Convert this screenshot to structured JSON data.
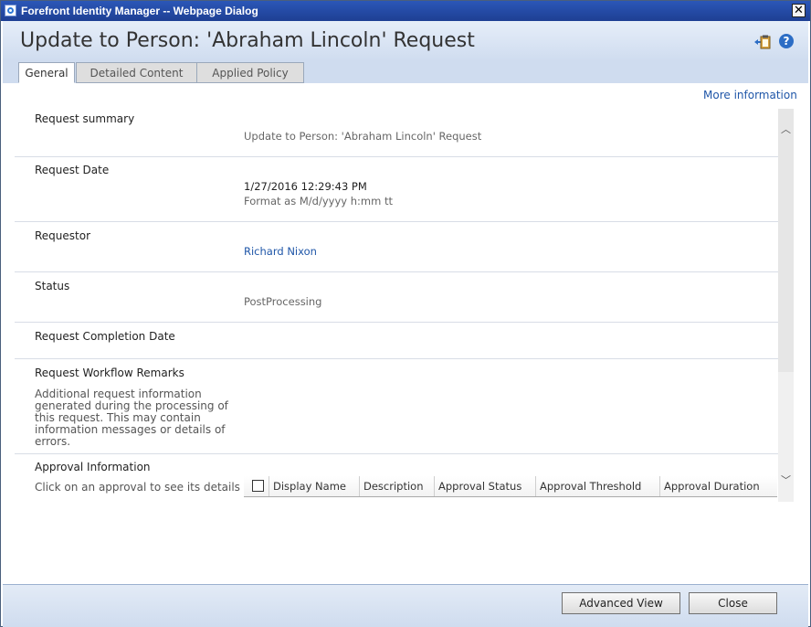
{
  "window": {
    "title": "Forefront Identity Manager -- Webpage Dialog",
    "close_glyph": "✕"
  },
  "header": {
    "title": "Update to Person: 'Abraham Lincoln' Request"
  },
  "tabs": [
    {
      "label": "General"
    },
    {
      "label": "Detailed Content"
    },
    {
      "label": "Applied Policy"
    }
  ],
  "more_info": "More information",
  "fields": {
    "summary": {
      "label": "Request summary",
      "value": "Update to Person: 'Abraham Lincoln' Request"
    },
    "date": {
      "label": "Request Date",
      "value": "1/27/2016 12:29:43 PM",
      "hint": "Format as M/d/yyyy h:mm tt"
    },
    "requestor": {
      "label": "Requestor",
      "value": "Richard Nixon"
    },
    "status": {
      "label": "Status",
      "value": "PostProcessing"
    },
    "completion": {
      "label": "Request Completion Date"
    },
    "remarks": {
      "label": "Request Workflow Remarks",
      "desc": "Additional request information generated during the processing of this request. This may contain information messages or details of errors."
    },
    "approval": {
      "label": "Approval Information",
      "desc": "Click on an approval to see its details"
    }
  },
  "approval_grid": {
    "columns": [
      "Display Name",
      "Description",
      "Approval Status",
      "Approval Threshold",
      "Approval Duration"
    ]
  },
  "footer": {
    "advanced_view": "Advanced View",
    "close": "Close"
  },
  "icons": {
    "export": "export-clipboard-icon",
    "help": "help-icon"
  },
  "colors": {
    "link": "#1f56a8",
    "titlebar": "#2b57b8"
  }
}
